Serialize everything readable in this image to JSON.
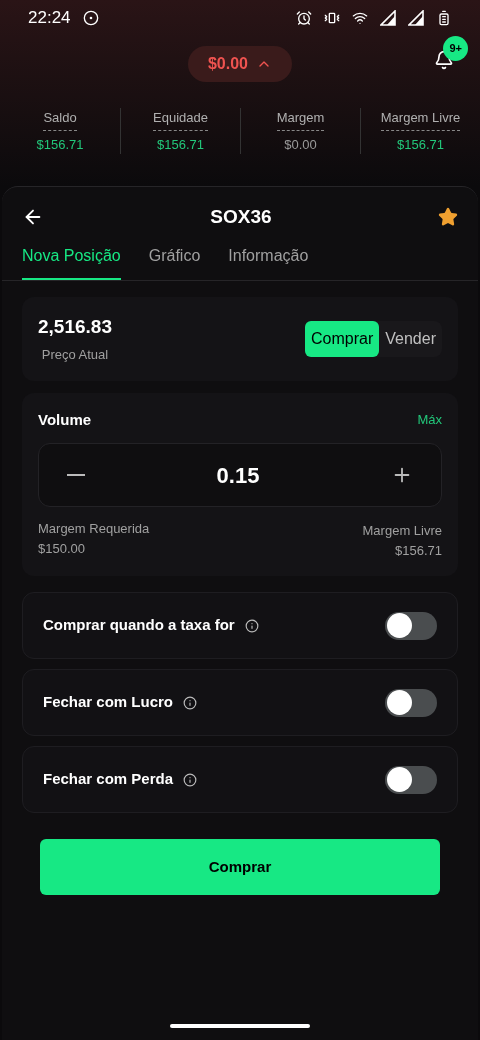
{
  "status_bar": {
    "time": "22:24"
  },
  "header": {
    "pnl": "$0.00",
    "notification_badge": "9+"
  },
  "stats": [
    {
      "label": "Saldo",
      "value": "$156.71",
      "color": "#22c77a"
    },
    {
      "label": "Equidade",
      "value": "$156.71",
      "color": "#22c77a"
    },
    {
      "label": "Margem",
      "value": "$0.00",
      "color": "#9a9a9a"
    },
    {
      "label": "Margem Livre",
      "value": "$156.71",
      "color": "#22c77a"
    }
  ],
  "instrument": {
    "title": "SOX36",
    "favorite": true
  },
  "tabs": [
    {
      "label": "Nova Posição",
      "selected": true
    },
    {
      "label": "Gráfico",
      "selected": false
    },
    {
      "label": "Informação",
      "selected": false
    }
  ],
  "price": {
    "value": "2,516.83",
    "caption": "Preço Atual"
  },
  "sides": [
    {
      "label": "Comprar",
      "selected": true
    },
    {
      "label": "Vender",
      "selected": false
    }
  ],
  "volume": {
    "label": "Volume",
    "max": "Máx",
    "value": "0.15",
    "required_label": "Margem Requerida",
    "required_value": "$150.00",
    "free_label": "Margem Livre",
    "free_value": "$156.71"
  },
  "options": [
    {
      "label": "Comprar quando a taxa for",
      "on": false
    },
    {
      "label": "Fechar com Lucro",
      "on": false
    },
    {
      "label": "Fechar com Perda",
      "on": false
    }
  ],
  "submit": "Comprar"
}
